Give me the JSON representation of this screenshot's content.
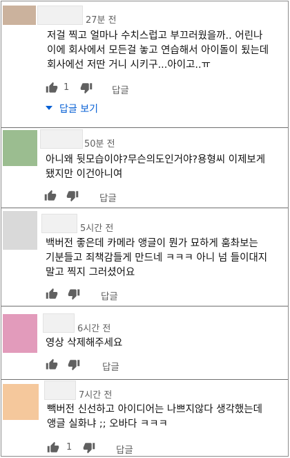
{
  "comments": [
    {
      "avatar_color": "#cbb29d",
      "time": "27분 전",
      "lines": [
        "저걸 찍고 얼마나 수치스럽고 부끄러웠을까.. 어린나",
        "이에 회사에서 모든걸 놓고 연습해서 아이돌이 됬는데",
        "회사에선 저딴 거니 시키구...아이고..ㅠ"
      ],
      "like_count": "1",
      "reply_label": "답글",
      "view_replies_label": "답글 보기"
    },
    {
      "avatar_color": "#9bbd90",
      "time": "50분 전",
      "lines": [
        "아니왜 뒷모습이야?무슨의도인거야?용형씨 이제보게",
        "됐지만 이건아니여"
      ],
      "like_count": "",
      "reply_label": "답글"
    },
    {
      "avatar_color": "#d9d9d9",
      "time": "5시간 전",
      "lines": [
        "백버전 좋은데 카메라 앵글이 뭔가 묘하게 훔촤보는",
        "기분들고 죄책감들게 만드네 ㅋㅋㅋ 아니 넘 들이대지",
        "말고 찍지 그러셨어요"
      ],
      "like_count": "",
      "reply_label": "답글"
    },
    {
      "avatar_color": "#e29bbb",
      "time": "6시간 전",
      "lines": [
        "영상 삭제해주세요"
      ],
      "like_count": "",
      "reply_label": "답글"
    },
    {
      "avatar_color": "#f5c89c",
      "time": "7시간 전",
      "lines": [
        "빽버전 신선하고 아이디어는 나쁘지않다 생각했는데",
        "앵글 실화냐 ;; 오바다 ㅋㅋㅋ"
      ],
      "like_count": "1",
      "reply_label": "답글"
    }
  ]
}
